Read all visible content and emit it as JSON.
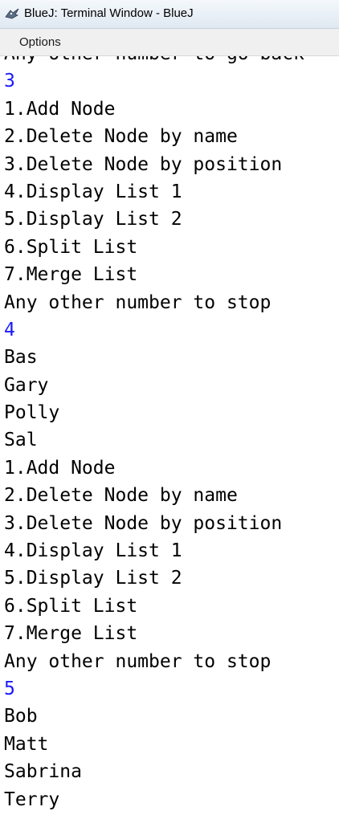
{
  "window": {
    "title": "BlueJ: Terminal Window - BlueJ"
  },
  "menubar": {
    "options_label": "Options"
  },
  "terminal": {
    "lines": [
      {
        "text": "Any other number to go back",
        "kind": "output"
      },
      {
        "text": "3",
        "kind": "input"
      },
      {
        "text": "1.Add Node",
        "kind": "output"
      },
      {
        "text": "2.Delete Node by name",
        "kind": "output"
      },
      {
        "text": "3.Delete Node by position",
        "kind": "output"
      },
      {
        "text": "4.Display List 1",
        "kind": "output"
      },
      {
        "text": "5.Display List 2",
        "kind": "output"
      },
      {
        "text": "6.Split List",
        "kind": "output"
      },
      {
        "text": "7.Merge List",
        "kind": "output"
      },
      {
        "text": "Any other number to stop",
        "kind": "output"
      },
      {
        "text": "4",
        "kind": "input"
      },
      {
        "text": "Bas",
        "kind": "output"
      },
      {
        "text": "Gary",
        "kind": "output"
      },
      {
        "text": "Polly",
        "kind": "output"
      },
      {
        "text": "Sal",
        "kind": "output"
      },
      {
        "text": "1.Add Node",
        "kind": "output"
      },
      {
        "text": "2.Delete Node by name",
        "kind": "output"
      },
      {
        "text": "3.Delete Node by position",
        "kind": "output"
      },
      {
        "text": "4.Display List 1",
        "kind": "output"
      },
      {
        "text": "5.Display List 2",
        "kind": "output"
      },
      {
        "text": "6.Split List",
        "kind": "output"
      },
      {
        "text": "7.Merge List",
        "kind": "output"
      },
      {
        "text": "Any other number to stop",
        "kind": "output"
      },
      {
        "text": "5",
        "kind": "input"
      },
      {
        "text": "Bob",
        "kind": "output"
      },
      {
        "text": "Matt",
        "kind": "output"
      },
      {
        "text": "Sabrina",
        "kind": "output"
      },
      {
        "text": "Terry",
        "kind": "output"
      }
    ]
  },
  "colors": {
    "input_text": "#1a1aff",
    "output_text": "#000000",
    "background": "#ffffff"
  },
  "icons": {
    "app_icon": "bluej-bird-icon"
  }
}
